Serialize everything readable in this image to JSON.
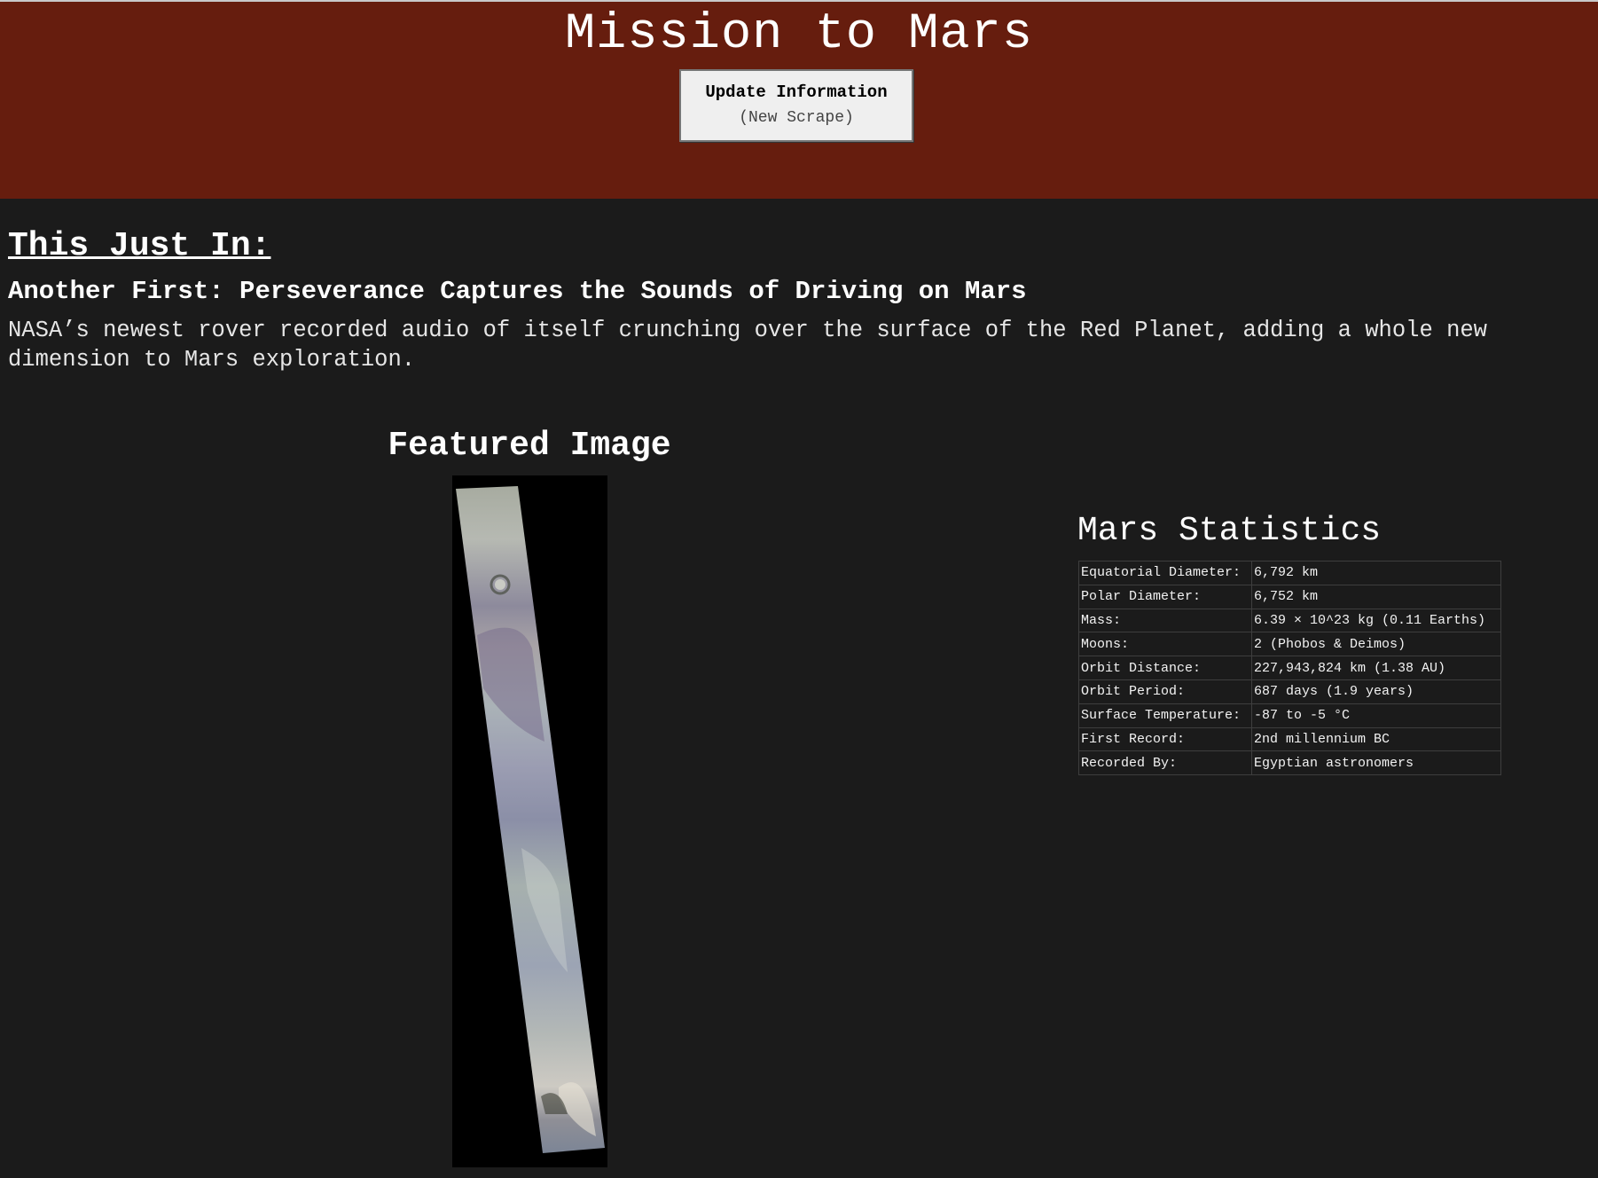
{
  "header": {
    "title": "Mission to Mars",
    "button_line1": "Update Information",
    "button_line2": "(New Scrape)"
  },
  "news": {
    "heading": "This Just In:",
    "title": "Another First: Perseverance Captures the Sounds of Driving on Mars",
    "paragraph": "NASA’s newest rover recorded audio of itself crunching over the surface of the Red Planet, adding a whole new dimension to Mars exploration."
  },
  "featured": {
    "heading": "Featured Image"
  },
  "stats": {
    "heading": "Mars Statistics",
    "rows": [
      {
        "label": "Equatorial Diameter:",
        "value": "6,792 km"
      },
      {
        "label": "Polar Diameter:",
        "value": "6,752 km"
      },
      {
        "label": "Mass:",
        "value": "6.39 × 10^23 kg (0.11 Earths)"
      },
      {
        "label": "Moons:",
        "value": "2 (Phobos & Deimos)"
      },
      {
        "label": "Orbit Distance:",
        "value": "227,943,824 km (1.38 AU)"
      },
      {
        "label": "Orbit Period:",
        "value": "687 days (1.9 years)"
      },
      {
        "label": "Surface Temperature:",
        "value": "-87 to -5 °C"
      },
      {
        "label": "First Record:",
        "value": "2nd millennium BC"
      },
      {
        "label": "Recorded By:",
        "value": "Egyptian astronomers"
      }
    ]
  }
}
